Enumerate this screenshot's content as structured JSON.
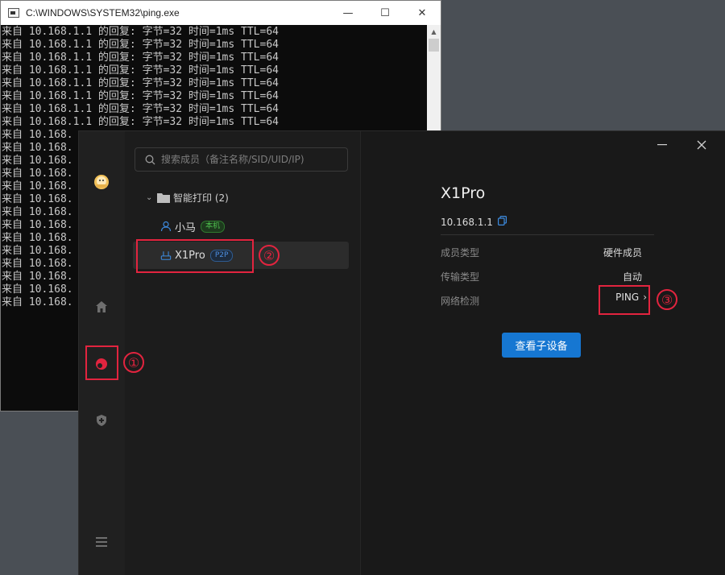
{
  "cmd_window": {
    "title": "C:\\WINDOWS\\SYSTEM32\\ping.exe",
    "controls": {
      "minimize": "—",
      "maximize": "☐",
      "close": "✕"
    },
    "lines": [
      "来自 10.168.1.1 的回复: 字节=32 时间=1ms TTL=64",
      "来自 10.168.1.1 的回复: 字节=32 时间=1ms TTL=64",
      "来自 10.168.1.1 的回复: 字节=32 时间=1ms TTL=64",
      "来自 10.168.1.1 的回复: 字节=32 时间=1ms TTL=64",
      "来自 10.168.1.1 的回复: 字节=32 时间=1ms TTL=64",
      "来自 10.168.1.1 的回复: 字节=32 时间=1ms TTL=64",
      "来自 10.168.1.1 的回复: 字节=32 时间=1ms TTL=64",
      "来自 10.168.1.1 的回复: 字节=32 时间=1ms TTL=64",
      "来自 10.168.",
      "来自 10.168.",
      "来自 10.168.",
      "来自 10.168.",
      "来自 10.168.",
      "来自 10.168.",
      "来自 10.168.",
      "来自 10.168.",
      "来自 10.168.",
      "来自 10.168.",
      "来自 10.168.",
      "来自 10.168.",
      "来自 10.168.",
      "来自 10.168."
    ]
  },
  "app": {
    "rail_icons": [
      "avatar-icon",
      "home-icon",
      "member-icon",
      "shield-icon",
      "menu-icon"
    ],
    "search": {
      "placeholder": "搜索成员（备注名称/SID/UID/IP)"
    },
    "group": {
      "label": "智能打印 (2)"
    },
    "members": [
      {
        "name": "小马",
        "badge": "本机",
        "icon": "user-icon"
      },
      {
        "name": "X1Pro",
        "badge": "P2P",
        "icon": "router-icon"
      }
    ],
    "detail": {
      "title": "X1Pro",
      "ip": "10.168.1.1",
      "rows": [
        {
          "label": "成员类型",
          "value": "硬件成员"
        },
        {
          "label": "传输类型",
          "value": "自动"
        },
        {
          "label": "网络检测",
          "value": "PING"
        }
      ],
      "button": "查看子设备"
    }
  },
  "annotations": [
    "①",
    "②",
    "③"
  ],
  "colors": {
    "accent": "#1677d2",
    "annotation": "#e2243f",
    "p2p_badge": "#4d8fe0",
    "local_badge": "#4fbf4f"
  }
}
